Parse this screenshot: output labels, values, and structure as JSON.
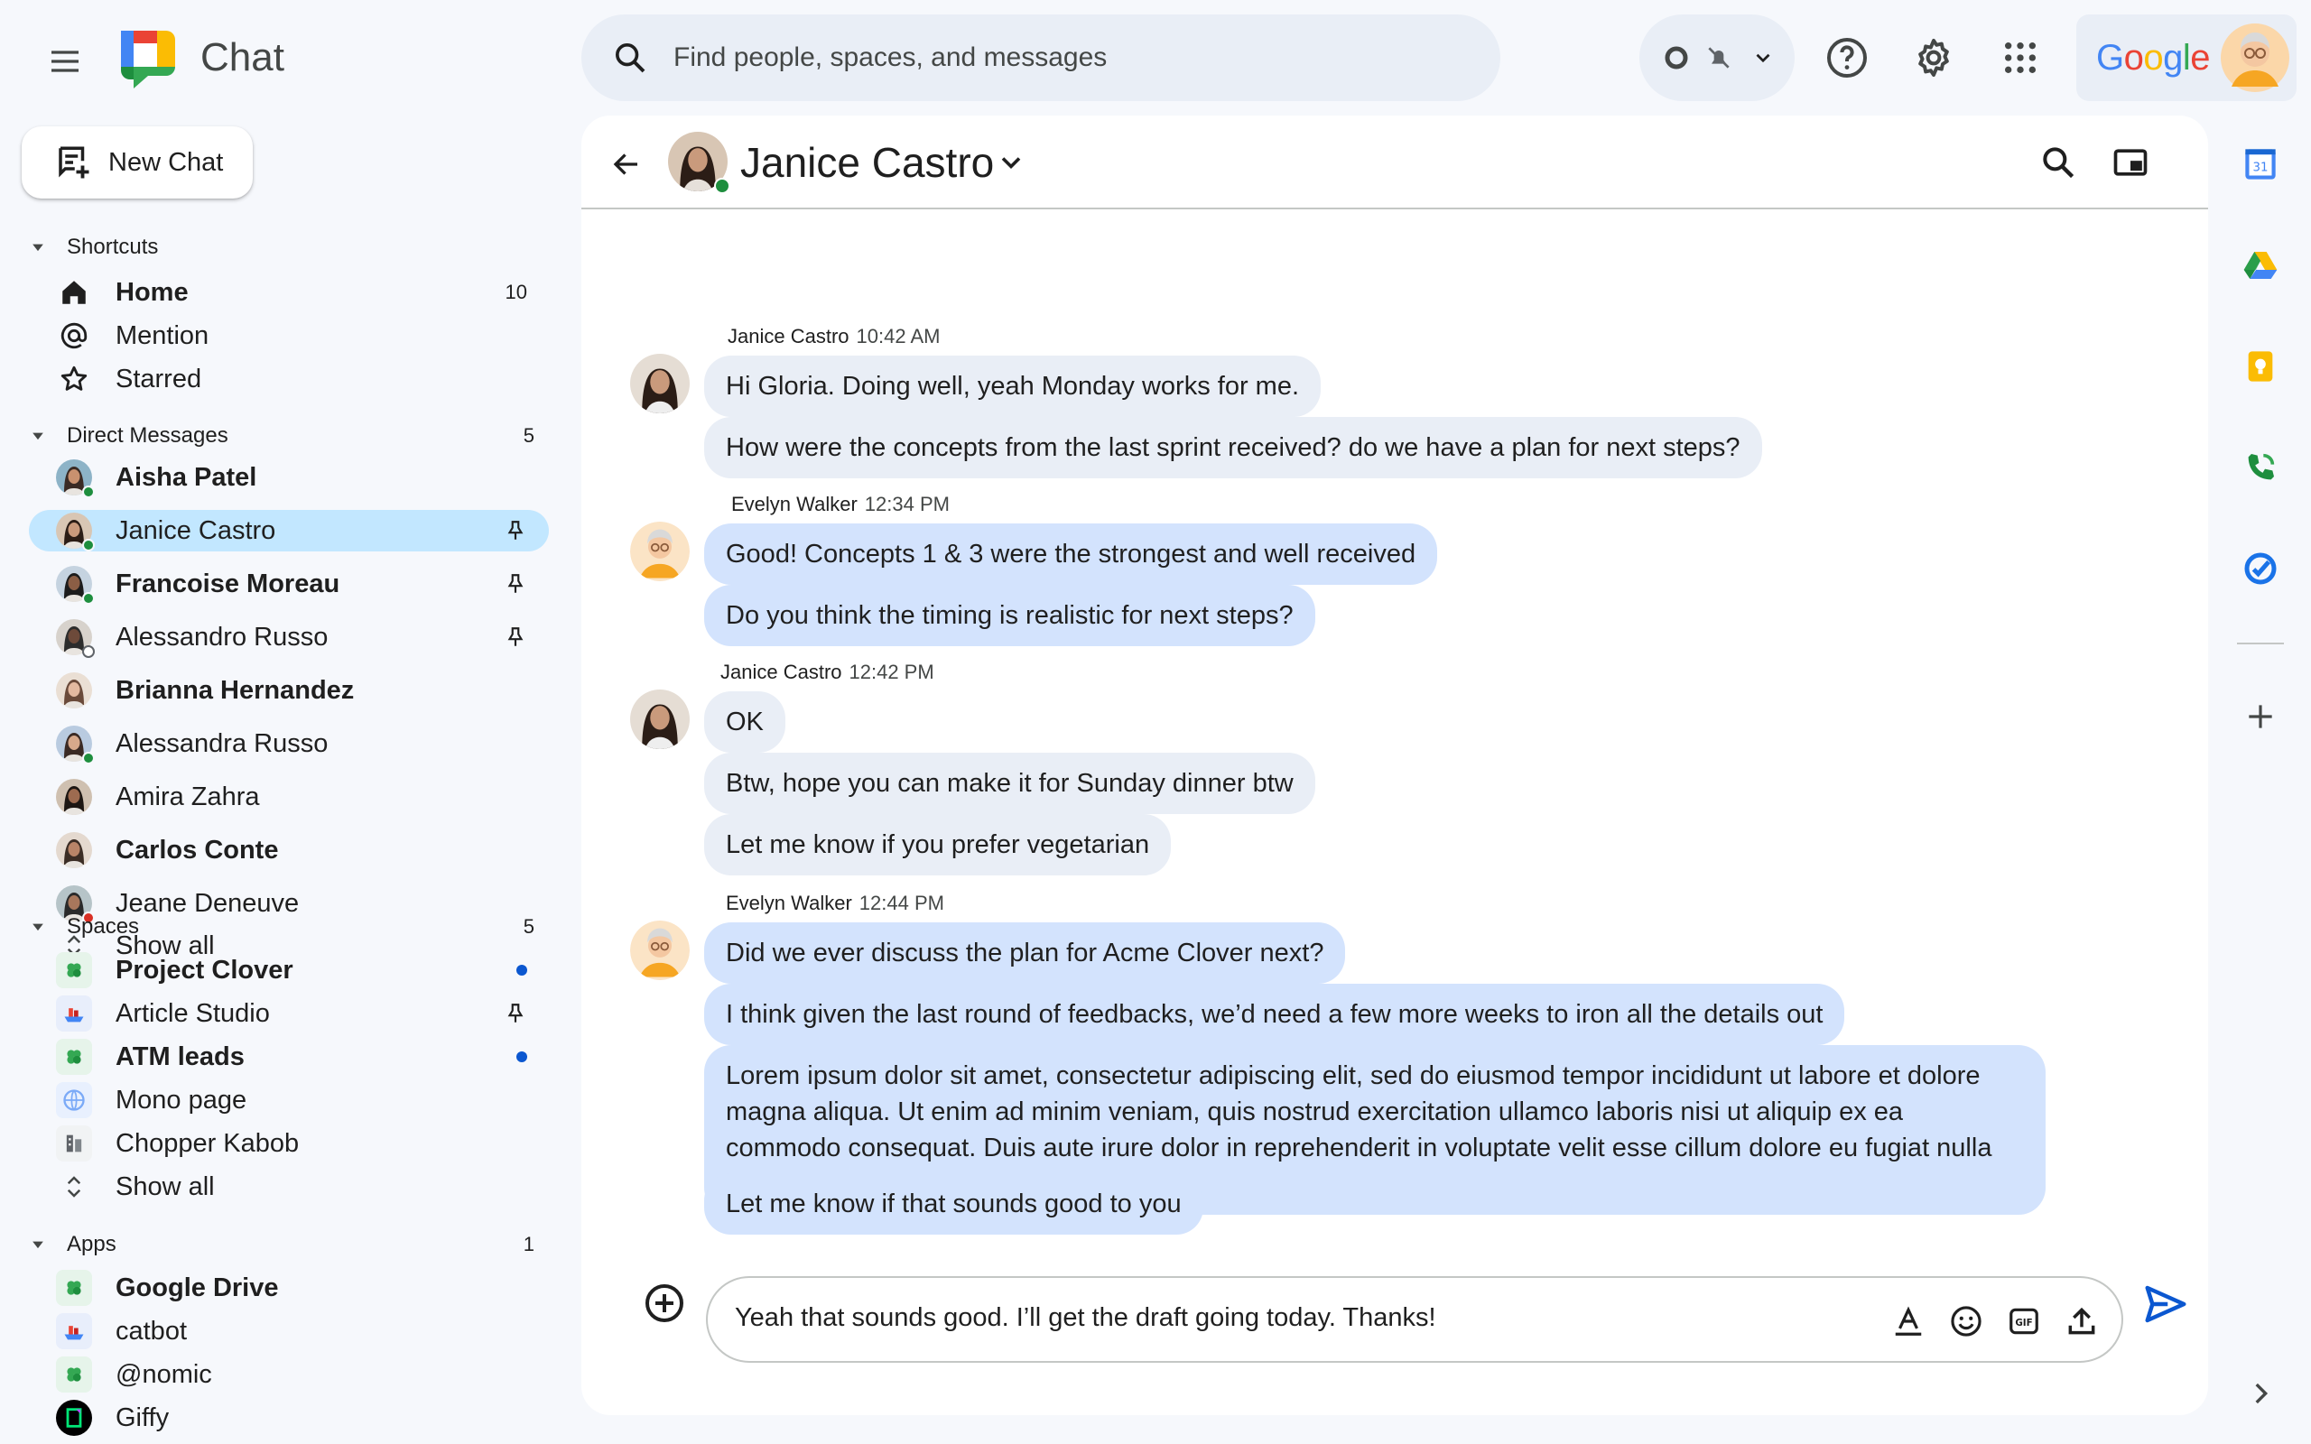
{
  "app": {
    "title": "Chat"
  },
  "search": {
    "placeholder": "Find people, spaces, and messages"
  },
  "account": {
    "brand": "Google"
  },
  "new_chat": {
    "label": "New Chat"
  },
  "shortcuts": {
    "label": "Shortcuts",
    "items": [
      {
        "label": "Home",
        "count": "10",
        "bold": true
      },
      {
        "label": "Mention"
      },
      {
        "label": "Starred"
      }
    ]
  },
  "direct_messages": {
    "label": "Direct Messages",
    "count": "5",
    "items": [
      {
        "label": "Aisha Patel",
        "bold": true,
        "presence": "online"
      },
      {
        "label": "Janice Castro",
        "selected": true,
        "pinned": true,
        "presence": "online"
      },
      {
        "label": "Francoise Moreau",
        "bold": true,
        "pinned": true,
        "presence": "online"
      },
      {
        "label": "Alessandro Russo",
        "pinned": true,
        "presence": "away"
      },
      {
        "label": "Brianna Hernandez",
        "bold": true
      },
      {
        "label": "Alessandra Russo",
        "presence": "online"
      },
      {
        "label": "Amira Zahra"
      },
      {
        "label": "Carlos Conte",
        "bold": true
      },
      {
        "label": "Jeane Deneuve",
        "presence": "dnd"
      }
    ],
    "show_all": "Show all"
  },
  "spaces": {
    "label": "Spaces",
    "count": "5",
    "items": [
      {
        "label": "Project Clover",
        "bold": true,
        "unread": true,
        "icon": "clover-icon"
      },
      {
        "label": "Article Studio",
        "pinned": true,
        "icon": "ship-icon"
      },
      {
        "label": "ATM leads",
        "bold": true,
        "unread": true,
        "icon": "clover-icon"
      },
      {
        "label": "Mono page",
        "icon": "globe-icon"
      },
      {
        "label": "Chopper Kabob",
        "icon": "building-icon"
      }
    ],
    "show_all": "Show all"
  },
  "apps": {
    "label": "Apps",
    "count": "1",
    "items": [
      {
        "label": "Google Drive",
        "bold": true,
        "icon": "clover-icon"
      },
      {
        "label": "catbot",
        "icon": "ship-icon"
      },
      {
        "label": "@nomic",
        "icon": "clover-icon"
      },
      {
        "label": "Giffy",
        "icon": "giffy-icon"
      }
    ]
  },
  "conversation": {
    "name": "Janice Castro",
    "groups": [
      {
        "sender": "Janice Castro",
        "time": "10:42 AM",
        "side": "other",
        "messages": [
          "Hi Gloria. Doing well, yeah Monday works for me.",
          "How were the concepts from the last sprint received? do we have a plan for next steps?"
        ]
      },
      {
        "sender": "Evelyn Walker",
        "time": "12:34 PM",
        "side": "mine",
        "messages": [
          "Good! Concepts 1 & 3 were the strongest and well received",
          "Do you think the timing is realistic for next steps?"
        ]
      },
      {
        "sender": "Janice Castro",
        "time": "12:42 PM",
        "side": "other",
        "messages": [
          "OK",
          "Btw, hope you can make it for Sunday dinner btw",
          "Let me know if you prefer vegetarian"
        ]
      },
      {
        "sender": "Evelyn Walker",
        "time": "12:44 PM",
        "side": "mine",
        "messages": [
          "Did we ever discuss the plan for Acme Clover next?",
          "I think given the last round of feedbacks, we’d need a few more weeks to iron all the details out",
          "Lorem ipsum dolor sit amet, consectetur adipiscing elit, sed do eiusmod tempor incididunt ut labore et dolore magna aliqua. Ut enim ad minim veniam, quis nostrud exercitation ullamco laboris nisi ut aliquip ex ea commodo consequat. Duis aute irure dolor in reprehenderit in voluptate velit esse cillum dolore eu fugiat nulla pariatur.",
          "Let me know if that sounds good to you"
        ]
      }
    ]
  },
  "composer": {
    "value": "Yeah that sounds good. I’ll get the draft going today. Thanks!",
    "gif_label": "GIF"
  },
  "right_rail": {
    "calendar_day": "31",
    "items": [
      "calendar-icon",
      "drive-icon",
      "keep-icon",
      "voice-icon",
      "tasks-icon",
      "add-icon"
    ]
  },
  "colors": {
    "background": "#f6f8fc",
    "selected": "#c2e7ff",
    "bubble_other": "#e9eef6",
    "bubble_mine": "#d3e3fd",
    "accent": "#0b57d0"
  }
}
